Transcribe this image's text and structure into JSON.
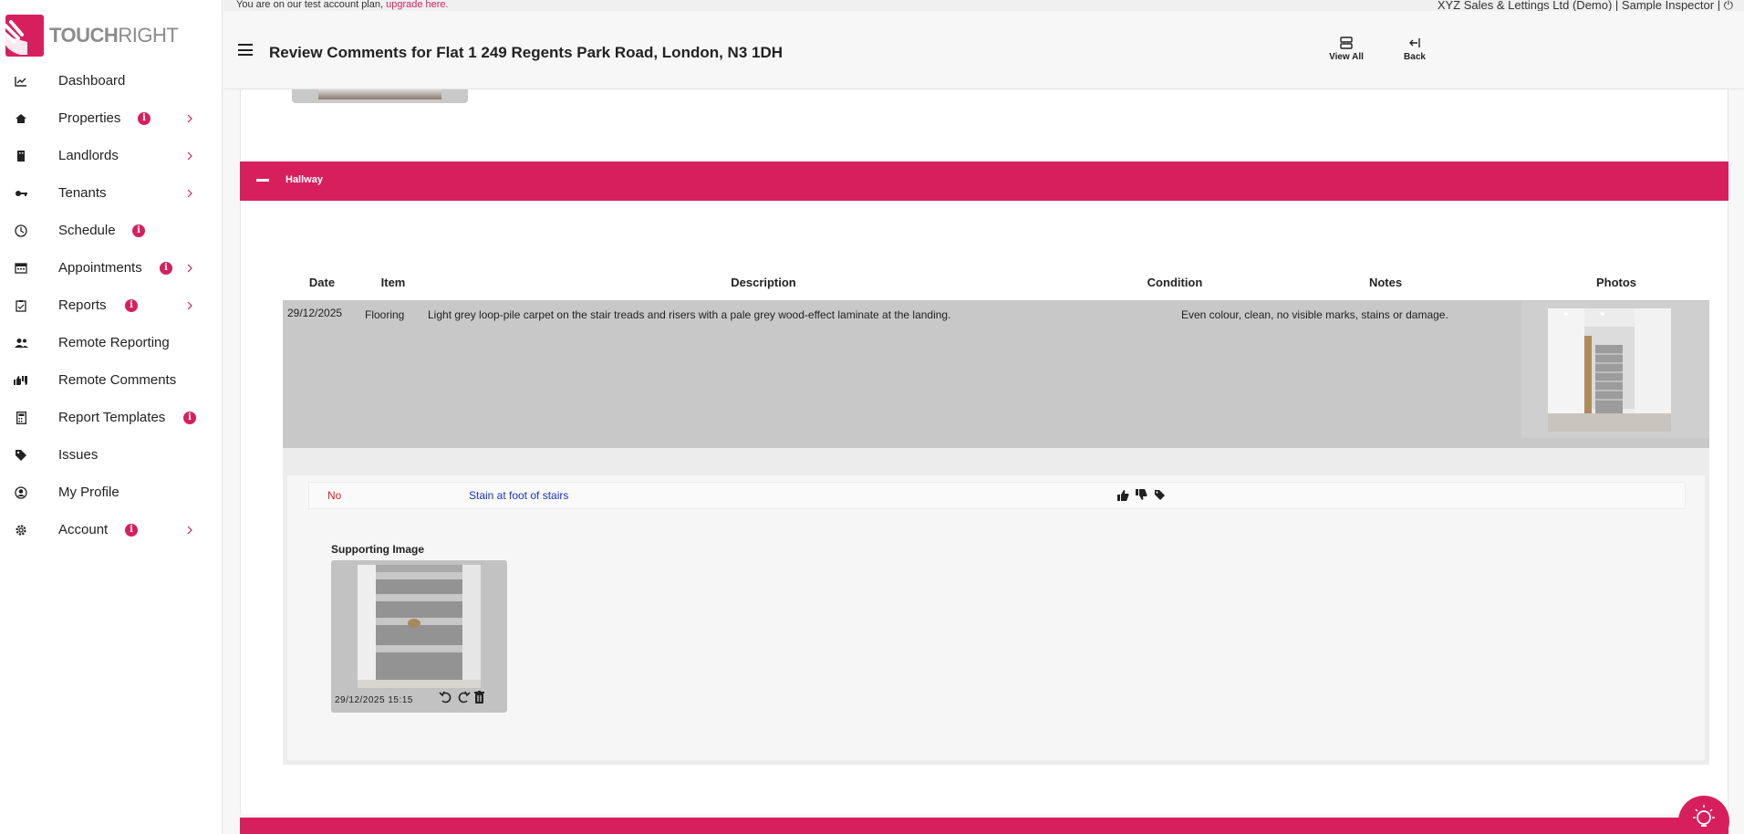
{
  "brand": {
    "name_bold": "TOUCH",
    "name_light": "RIGHT",
    "accent": "#d81f5e"
  },
  "topline": {
    "plan_text": "You are on our test account plan,",
    "upgrade_link": "upgrade here.",
    "account_text": "XYZ Sales & Lettings Ltd (Demo) | Sample Inspector |"
  },
  "header": {
    "title": "Review Comments for Flat 1 249 Regents Park Road, London, N3 1DH",
    "view_all": "View All",
    "back": "Back"
  },
  "sidebar": {
    "items": [
      {
        "label": "Dashboard",
        "icon": "chart-line-icon",
        "badge": false,
        "chevron": false
      },
      {
        "label": "Properties",
        "icon": "home-icon",
        "badge": true,
        "chevron": true
      },
      {
        "label": "Landlords",
        "icon": "building-icon",
        "badge": false,
        "chevron": true
      },
      {
        "label": "Tenants",
        "icon": "key-icon",
        "badge": false,
        "chevron": true
      },
      {
        "label": "Schedule",
        "icon": "clock-icon",
        "badge": true,
        "chevron": false
      },
      {
        "label": "Appointments",
        "icon": "calendar-icon",
        "badge": true,
        "chevron": true
      },
      {
        "label": "Reports",
        "icon": "clipboard-icon",
        "badge": true,
        "chevron": true
      },
      {
        "label": "Remote Reporting",
        "icon": "users-icon",
        "badge": false,
        "chevron": false
      },
      {
        "label": "Remote Comments",
        "icon": "thumbs-icon",
        "badge": false,
        "chevron": false
      },
      {
        "label": "Report Templates",
        "icon": "calculator-icon",
        "badge": true,
        "chevron": false
      },
      {
        "label": "Issues",
        "icon": "tag-icon",
        "badge": false,
        "chevron": false
      },
      {
        "label": "My Profile",
        "icon": "user-circle-icon",
        "badge": false,
        "chevron": false
      },
      {
        "label": "Account",
        "icon": "gear-icon",
        "badge": true,
        "chevron": true
      }
    ],
    "badge_glyph": "i"
  },
  "section": {
    "name": "Hallway"
  },
  "table": {
    "headers": [
      "Date",
      "Item",
      "Description",
      "Condition",
      "Notes",
      "Photos"
    ],
    "row": {
      "date": "29/12/2025",
      "item": "Flooring",
      "description": "Light grey loop-pile carpet on the stair treads and risers with a pale grey wood-effect laminate at the landing.",
      "condition": "",
      "notes": "Even colour, clean, no visible marks, stains or damage."
    }
  },
  "comment": {
    "agreed": "No",
    "text": "Stain at foot of stairs",
    "supporting_label": "Supporting Image",
    "image_timestamp": "29/12/2025 15:15"
  }
}
